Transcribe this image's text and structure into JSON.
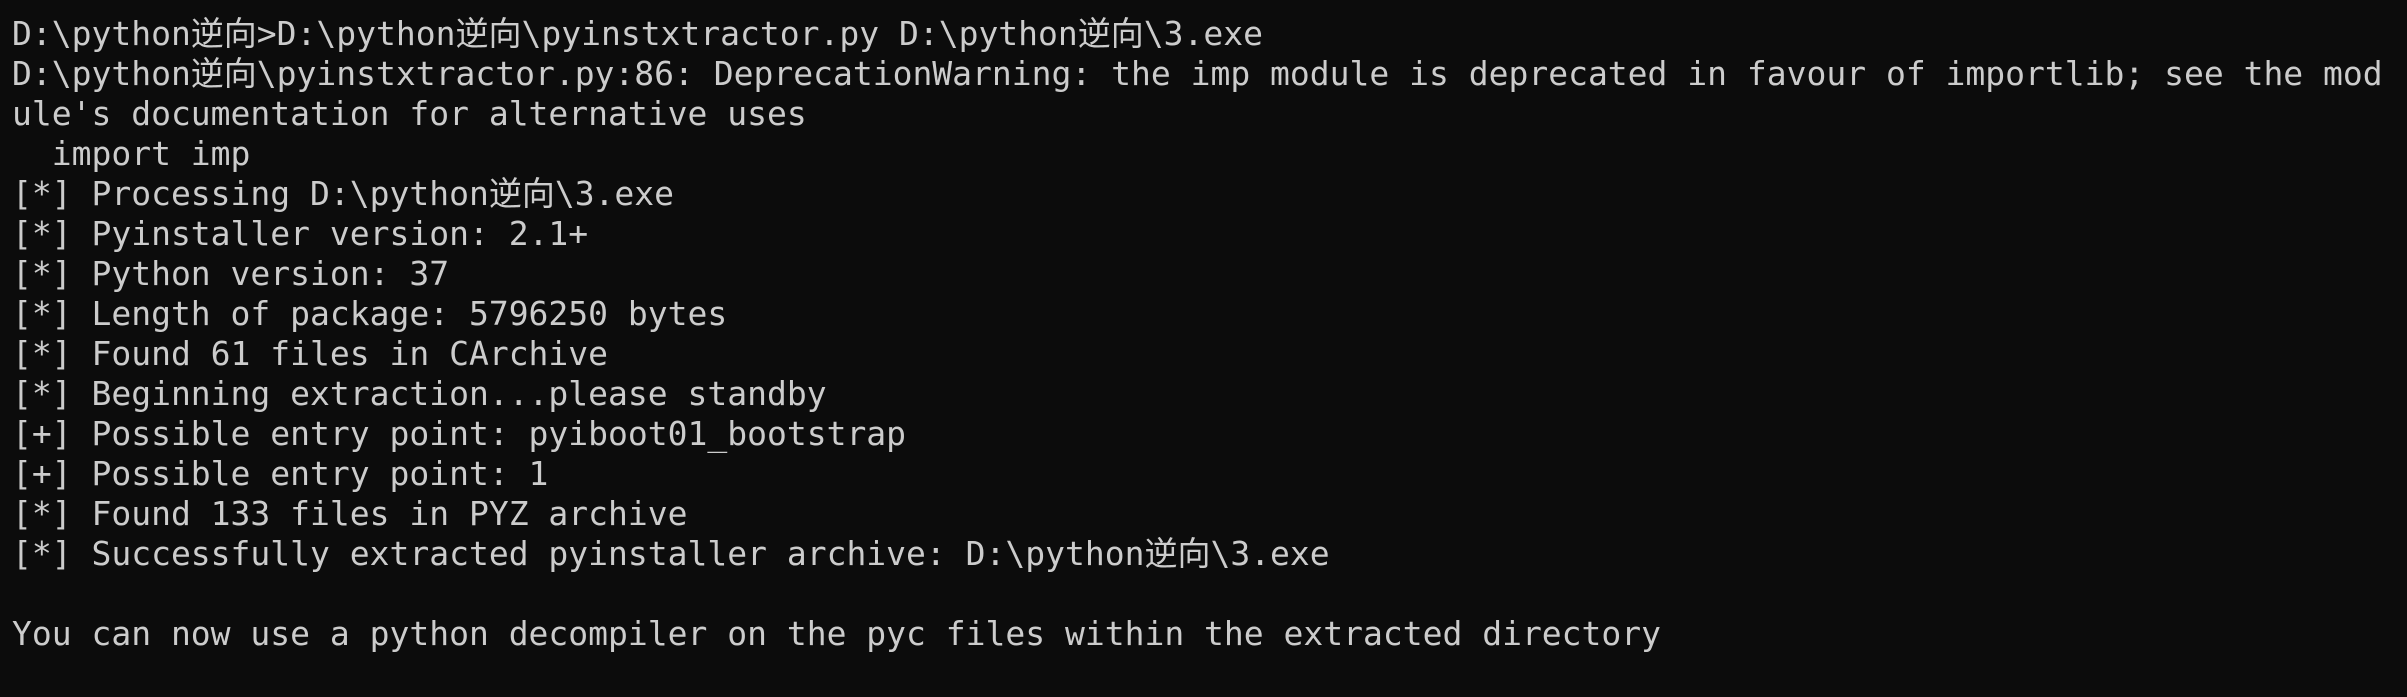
{
  "console": {
    "lines": [
      "D:\\python逆向>D:\\python逆向\\pyinstxtractor.py D:\\python逆向\\3.exe",
      "D:\\python逆向\\pyinstxtractor.py:86: DeprecationWarning: the imp module is deprecated in favour of importlib; see the mod",
      "ule's documentation for alternative uses",
      "  import imp",
      "[*] Processing D:\\python逆向\\3.exe",
      "[*] Pyinstaller version: 2.1+",
      "[*] Python version: 37",
      "[*] Length of package: 5796250 bytes",
      "[*] Found 61 files in CArchive",
      "[*] Beginning extraction...please standby",
      "[+] Possible entry point: pyiboot01_bootstrap",
      "[+] Possible entry point: 1",
      "[*] Found 133 files in PYZ archive",
      "[*] Successfully extracted pyinstaller archive: D:\\python逆向\\3.exe",
      "",
      "You can now use a python decompiler on the pyc files within the extracted directory"
    ]
  },
  "colors": {
    "background": "#0c0c0c",
    "text": "#cccccc"
  }
}
